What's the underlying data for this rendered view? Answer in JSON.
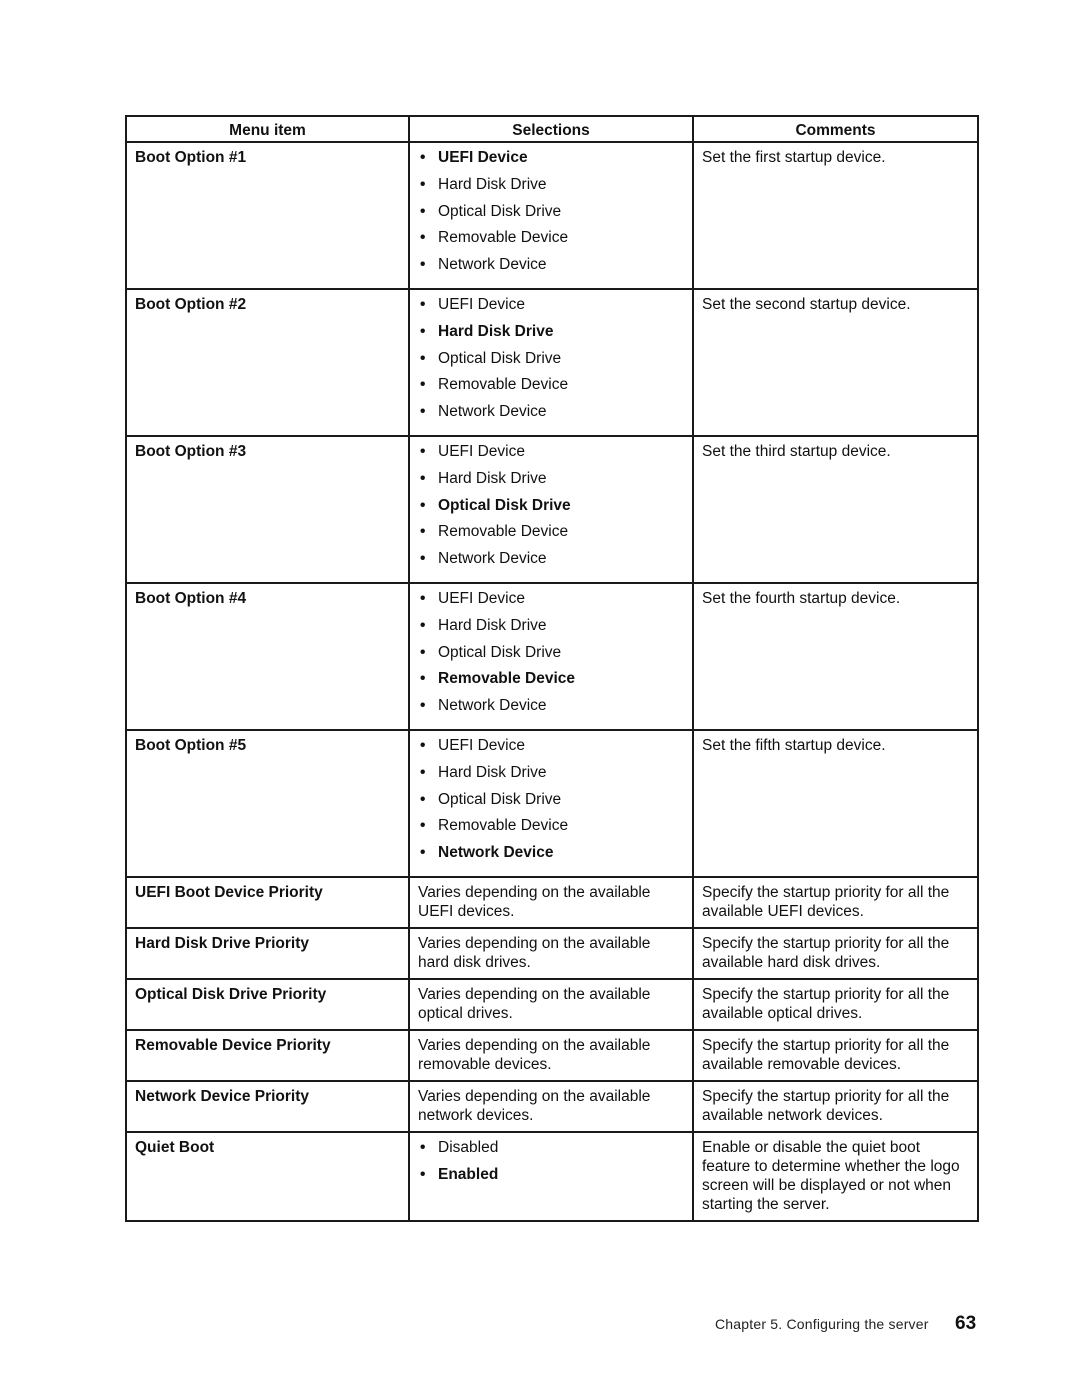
{
  "table": {
    "headers": [
      "Menu item",
      "Selections",
      "Comments"
    ],
    "boot_options": [
      {
        "menu_item": "Boot Option #1",
        "selections": [
          {
            "label": "UEFI Device",
            "default": true
          },
          {
            "label": "Hard Disk Drive",
            "default": false
          },
          {
            "label": "Optical Disk Drive",
            "default": false
          },
          {
            "label": "Removable Device",
            "default": false
          },
          {
            "label": "Network Device",
            "default": false
          }
        ],
        "comment": "Set the first startup device."
      },
      {
        "menu_item": "Boot Option #2",
        "selections": [
          {
            "label": "UEFI Device",
            "default": false
          },
          {
            "label": "Hard Disk Drive",
            "default": true
          },
          {
            "label": "Optical Disk Drive",
            "default": false
          },
          {
            "label": "Removable Device",
            "default": false
          },
          {
            "label": "Network Device",
            "default": false
          }
        ],
        "comment": "Set the second startup device."
      },
      {
        "menu_item": "Boot Option #3",
        "selections": [
          {
            "label": "UEFI Device",
            "default": false
          },
          {
            "label": "Hard Disk Drive",
            "default": false
          },
          {
            "label": "Optical Disk Drive",
            "default": true
          },
          {
            "label": "Removable Device",
            "default": false
          },
          {
            "label": "Network Device",
            "default": false
          }
        ],
        "comment": "Set the third startup device."
      },
      {
        "menu_item": "Boot Option #4",
        "selections": [
          {
            "label": "UEFI Device",
            "default": false
          },
          {
            "label": "Hard Disk Drive",
            "default": false
          },
          {
            "label": "Optical Disk Drive",
            "default": false
          },
          {
            "label": "Removable Device",
            "default": true
          },
          {
            "label": "Network Device",
            "default": false
          }
        ],
        "comment": "Set the fourth startup device."
      },
      {
        "menu_item": "Boot Option #5",
        "selections": [
          {
            "label": "UEFI Device",
            "default": false
          },
          {
            "label": "Hard Disk Drive",
            "default": false
          },
          {
            "label": "Optical Disk Drive",
            "default": false
          },
          {
            "label": "Removable Device",
            "default": false
          },
          {
            "label": "Network Device",
            "default": true
          }
        ],
        "comment": "Set the fifth startup device."
      }
    ],
    "priorities": [
      {
        "menu_item": "UEFI Boot Device Priority",
        "selection": "Varies depending on the available UEFI devices.",
        "comment": "Specify the startup priority for all the available UEFI devices."
      },
      {
        "menu_item": "Hard Disk Drive Priority",
        "selection": "Varies depending on the available hard disk drives.",
        "comment": "Specify the startup priority for all the available hard disk drives."
      },
      {
        "menu_item": "Optical Disk Drive Priority",
        "selection": "Varies depending on the available optical drives.",
        "comment": "Specify the startup priority for all the available optical drives."
      },
      {
        "menu_item": "Removable Device Priority",
        "selection": "Varies depending on the available removable devices.",
        "comment": "Specify the startup priority for all the available removable devices."
      },
      {
        "menu_item": "Network Device Priority",
        "selection": "Varies depending on the available network devices.",
        "comment": "Specify the startup priority for all the available network devices."
      }
    ],
    "quiet_boot": {
      "menu_item": "Quiet Boot",
      "selections": [
        {
          "label": "Disabled",
          "default": false
        },
        {
          "label": "Enabled",
          "default": true
        }
      ],
      "comment": "Enable or disable the quiet boot feature to determine whether the logo screen will be displayed or not when starting the server."
    }
  },
  "footer": {
    "chapter": "Chapter 5. Configuring the server",
    "page_number": "63"
  }
}
